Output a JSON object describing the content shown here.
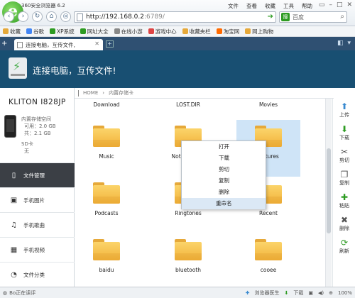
{
  "browser": {
    "app_title": "360安全浏览器 6.2",
    "logo_glyph": "e",
    "menu": [
      "文件",
      "查看",
      "收藏",
      "工具",
      "帮助"
    ],
    "window_controls": [
      "▭",
      "–",
      "□",
      "✕"
    ],
    "nav": {
      "back": "‹",
      "forward": "›",
      "refresh": "↻",
      "home": "⌂",
      "shield": "◎"
    },
    "address": {
      "host": "http://192.168.0.2",
      "port": ":6789/"
    },
    "search": {
      "engine_glyph": "搜",
      "placeholder": "百度",
      "go_glyph": "⌕"
    }
  },
  "favorites": [
    {
      "label": "收藏",
      "color": "#e6a93a"
    },
    {
      "label": "谷歌",
      "color": "#4285f4"
    },
    {
      "label": "XP系统",
      "color": "#2d9b22"
    },
    {
      "label": "网址大全",
      "color": "#2d9b22"
    },
    {
      "label": "在线小游",
      "color": "#888888"
    },
    {
      "label": "游戏中心",
      "color": "#d44"
    },
    {
      "label": "收藏夹栏",
      "color": "#e6a93a"
    },
    {
      "label": "淘宝网",
      "color": "#ff6a00"
    },
    {
      "label": "网上购物",
      "color": "#e6a93a"
    }
  ],
  "tabs": {
    "add_left": "+",
    "active_label": "连接电脑，互传文件,",
    "close_glyph": "✕",
    "new_tab_glyph": "+",
    "right_glyphs": [
      "◧",
      "▾"
    ]
  },
  "app": {
    "headline": "连接电脑，互传文件!",
    "bolt_glyph": "⚡",
    "device": {
      "name": "KLITON I828JP",
      "internal_storage": "内置存储空间",
      "available": "可用：2.0 GB",
      "total": "共：2.1 GB",
      "sd_label": "SD卡",
      "sd_value": "无"
    },
    "nav_items": [
      {
        "label": "文件管理",
        "icon": "▯",
        "icon_name": "phone-icon",
        "active": true
      },
      {
        "label": "手机图片",
        "icon": "▣",
        "icon_name": "image-icon",
        "active": false
      },
      {
        "label": "手机歌曲",
        "icon": "♫",
        "icon_name": "music-icon",
        "active": false
      },
      {
        "label": "手机视频",
        "icon": "▦",
        "icon_name": "video-icon",
        "active": false
      },
      {
        "label": "文件分类",
        "icon": "◔",
        "icon_name": "category-icon",
        "active": false
      }
    ],
    "path": {
      "home": "HOME",
      "separator": "›",
      "current": "内置存储卡"
    },
    "top_row_labels": [
      "Download",
      "LOST.DIR",
      "Movies"
    ],
    "folders": [
      "Music",
      "Notifications",
      "Pictures",
      "Podcasts",
      "Ringtones",
      "Recent",
      "baidu",
      "bluetooth",
      "cooee"
    ],
    "selected_folder": "Pictures",
    "context_menu": {
      "items": [
        "打开",
        "下载",
        "剪切",
        "复制",
        "删除",
        "重命名"
      ],
      "highlighted": "重命名"
    },
    "right_toolbar": [
      {
        "label": "上传",
        "icon": "⬆",
        "icon_name": "upload-icon",
        "color": "#3a8ad0"
      },
      {
        "label": "下载",
        "icon": "⬇",
        "icon_name": "download-icon",
        "color": "#2d9b22"
      },
      {
        "label": "剪切",
        "icon": "✂",
        "icon_name": "scissors-icon",
        "color": "#555555"
      },
      {
        "label": "复制",
        "icon": "❐",
        "icon_name": "copy-icon",
        "color": "#555555"
      },
      {
        "label": "粘贴",
        "icon": "✚",
        "icon_name": "paste-icon",
        "color": "#2d9b22"
      },
      {
        "label": "删除",
        "icon": "✖",
        "icon_name": "delete-icon",
        "color": "#555555"
      },
      {
        "label": "刷新",
        "icon": "⟳",
        "icon_name": "refresh-icon",
        "color": "#2d9b22"
      }
    ]
  },
  "status": {
    "left_text": "Bo正在读评",
    "doctor": "浏览器医生",
    "download": "下载",
    "zoom": "100%"
  }
}
